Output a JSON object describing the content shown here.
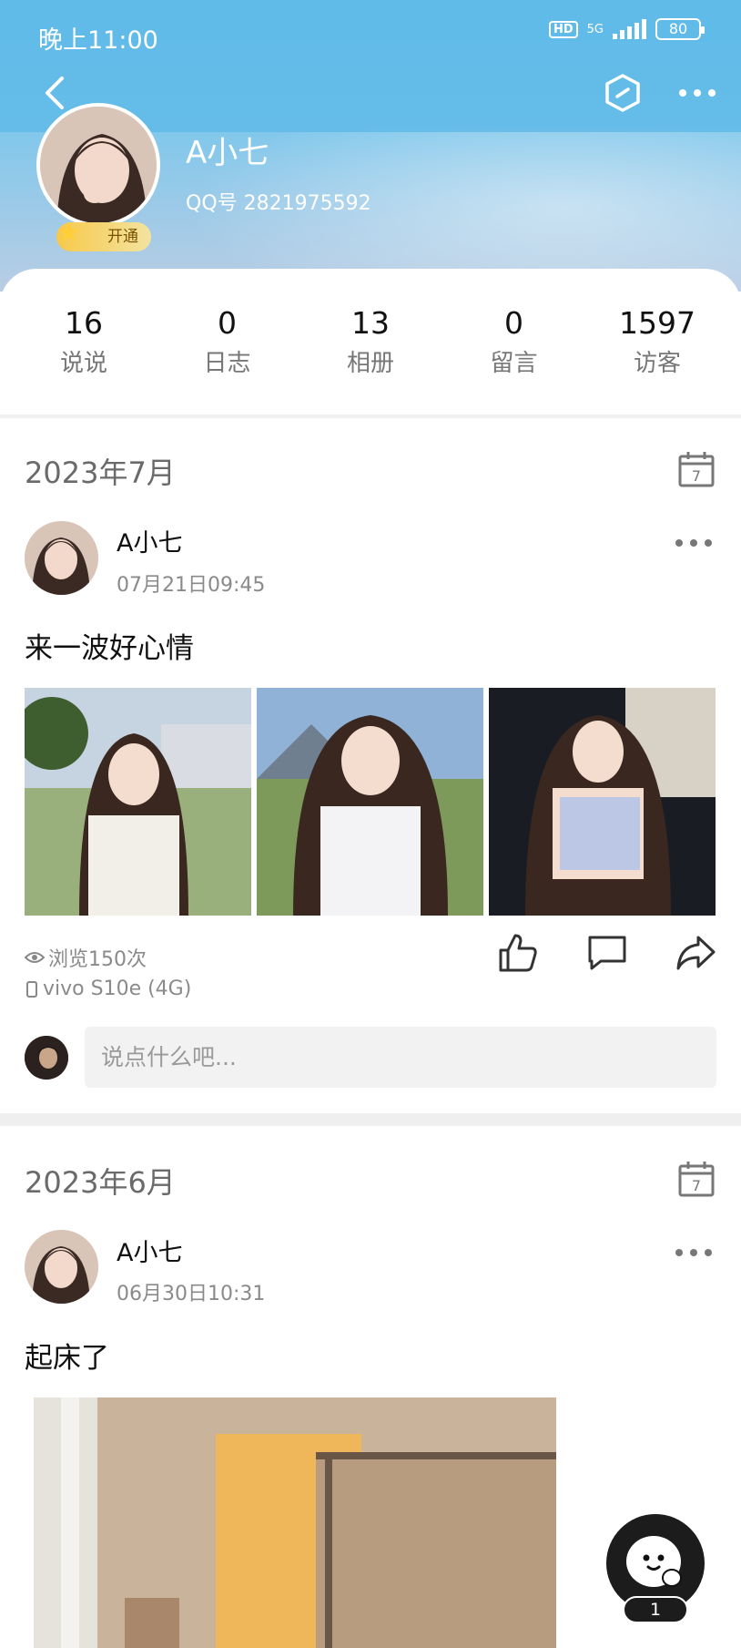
{
  "status_bar": {
    "time": "晚上11:00",
    "hd": "HD",
    "network": "5G",
    "battery": "80"
  },
  "profile": {
    "name": "A小七",
    "qq_number": "QQ号 2821975592",
    "vip_label": "开通"
  },
  "stats": [
    {
      "num": "16",
      "label": "说说"
    },
    {
      "num": "0",
      "label": "日志"
    },
    {
      "num": "13",
      "label": "相册"
    },
    {
      "num": "0",
      "label": "留言"
    },
    {
      "num": "1597",
      "label": "访客"
    }
  ],
  "posts": [
    {
      "month": "2023年7月",
      "calendar_day": "7",
      "author": "A小七",
      "time": "07月21日09:45",
      "text": "来一波好心情",
      "views": "浏览150次",
      "device": "vivo S10e (4G)",
      "comment_placeholder": "说点什么吧..."
    },
    {
      "month": "2023年6月",
      "calendar_day": "7",
      "author": "A小七",
      "time": "06月30日10:31",
      "text": "起床了"
    }
  ],
  "fab": {
    "badge": "1"
  },
  "colors": {
    "header_blue": "#5fc0e8",
    "vip_gold": "#f7c94a",
    "fab_dark": "#1c1c1c"
  }
}
